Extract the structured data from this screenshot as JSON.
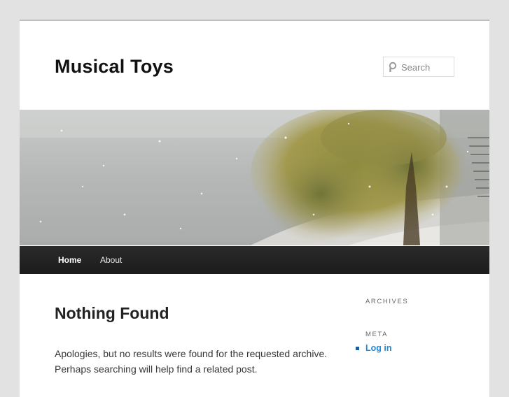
{
  "site": {
    "title": "Musical Toys"
  },
  "search": {
    "placeholder": "Search",
    "icon": "search-icon"
  },
  "nav": {
    "items": [
      {
        "label": "Home",
        "active": true
      },
      {
        "label": "About",
        "active": false
      }
    ]
  },
  "main": {
    "title": "Nothing Found",
    "text": "Apologies, but no results were found for the requested archive. Perhaps searching will help find a related post."
  },
  "sidebar": {
    "archives_title": "Archives",
    "meta_title": "Meta",
    "meta_items": [
      {
        "label": "Log in"
      }
    ]
  },
  "colors": {
    "nav_background": "#252525",
    "link": "#1b8be0",
    "page_background": "#e2e2e2"
  }
}
